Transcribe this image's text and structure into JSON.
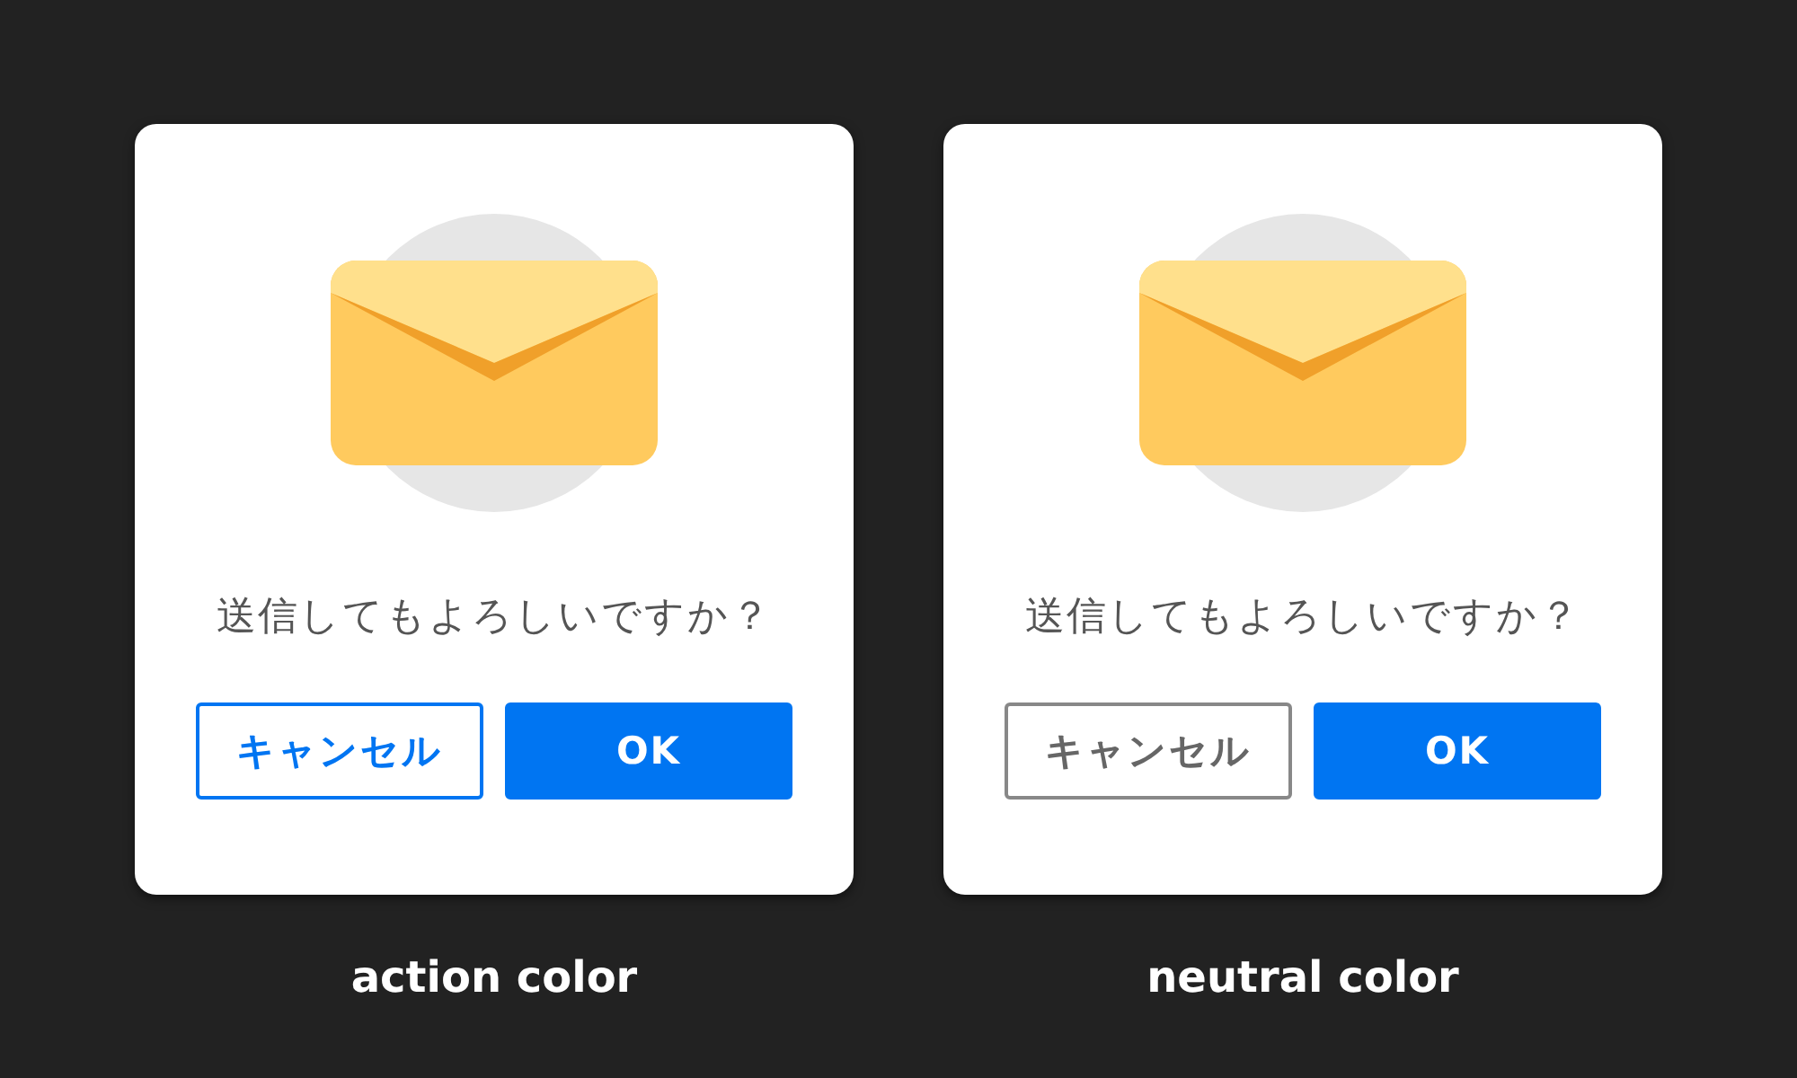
{
  "dialogs": [
    {
      "kind": "action",
      "message": "送信してもよろしいですか？",
      "buttons": [
        {
          "label": "キャンセル",
          "kind": "secondary"
        },
        {
          "label": "OK",
          "kind": "primary"
        }
      ],
      "caption": "action color"
    },
    {
      "kind": "neutral",
      "message": "送信してもよろしいですか？",
      "buttons": [
        {
          "label": "キャンセル",
          "kind": "secondary"
        },
        {
          "label": "OK",
          "kind": "primary"
        }
      ],
      "caption": "neutral color"
    }
  ]
}
